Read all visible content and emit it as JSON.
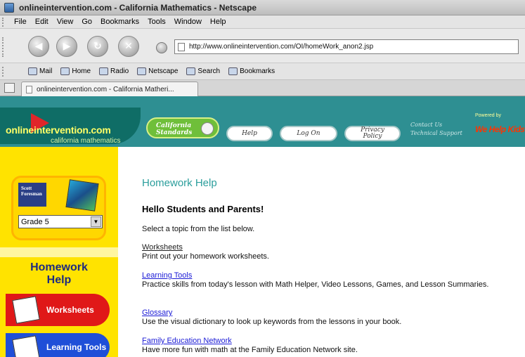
{
  "window": {
    "title": "onlineintervention.com - California Mathematics - Netscape"
  },
  "menu": [
    "File",
    "Edit",
    "View",
    "Go",
    "Bookmarks",
    "Tools",
    "Window",
    "Help"
  ],
  "address_bar": {
    "url": "http://www.onlineintervention.com/OI/homeWork_anon2.jsp"
  },
  "personal_toolbar": [
    "Mail",
    "Home",
    "Radio",
    "Netscape",
    "Search",
    "Bookmarks"
  ],
  "tab": {
    "label": "onlineintervention.com - California Matheri..."
  },
  "site_header": {
    "logo": "onlineintervention.com",
    "logo_sub": "california mathematics",
    "standards": "California Standards",
    "help": "Help",
    "log_on": "Log On",
    "privacy": "Privacy Policy",
    "contact": "Contact Us",
    "support": "Technical Support",
    "powered_by": "Powered by",
    "brand": "We Help Kids"
  },
  "sidebar": {
    "badge": "Scott Foresman",
    "grade_selected": "Grade 5",
    "section_title": "Homework Help",
    "buttons": [
      "Worksheets",
      "Learning Tools"
    ]
  },
  "main": {
    "title": "Homework Help",
    "greeting": "Hello Students and Parents!",
    "intro": "Select a topic from the list below.",
    "topics": [
      {
        "label": "Worksheets",
        "desc": "Print out your homework worksheets."
      },
      {
        "label": "Learning Tools",
        "desc": "Practice skills from today's lesson with Math Helper, Video Lessons, Games, and Lesson Summaries."
      },
      {
        "label": "Glossary",
        "desc": "Use the visual dictionary to look up keywords from the lessons in your book."
      },
      {
        "label": "Family Education Network",
        "desc": "Have more fun with math at the Family Education Network site."
      }
    ]
  }
}
